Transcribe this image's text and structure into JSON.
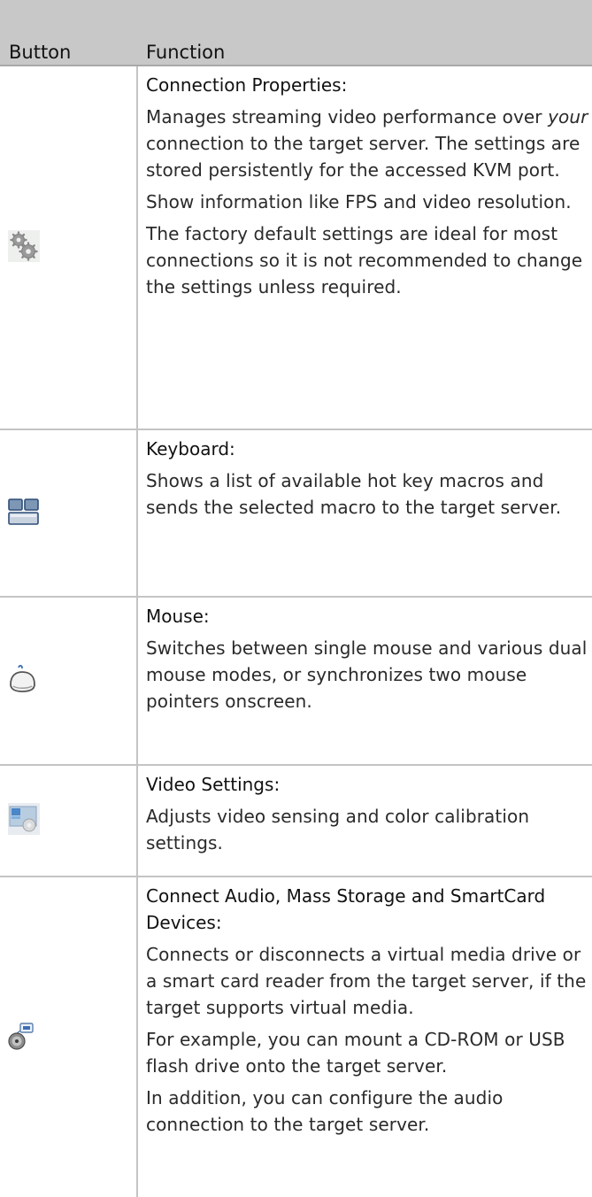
{
  "header": {
    "col_button": "Button",
    "col_function": "Function"
  },
  "rows": [
    {
      "icon": "gears-icon",
      "title": "Connection Properties",
      "title_suffix": ":",
      "p1_pre": "Manages streaming video performance over ",
      "p1_em": "your",
      "p1_post": " connection to the target server. The settings are stored persistently for the accessed KVM port.",
      "p2": "Show information like FPS and video resolution.",
      "p3": "The factory default settings are ideal for most connections so it is not recommended to change the settings unless required."
    },
    {
      "icon": "keyboard-icon",
      "title": "Keyboard",
      "title_suffix": ":",
      "p1": "Shows a list of available hot key macros and sends the selected macro to the target server."
    },
    {
      "icon": "mouse-icon",
      "title": "Mouse",
      "title_suffix": ":",
      "p1": "Switches between single mouse and various dual mouse modes, or synchronizes two mouse pointers onscreen."
    },
    {
      "icon": "video-settings-icon",
      "title": "Video Settings",
      "title_suffix": ":",
      "p1": "Adjusts video sensing and color calibration settings."
    },
    {
      "icon": "media-devices-icon",
      "title": "Connect Audio, Mass Storage and SmartCard Devices",
      "title_suffix": ":",
      "p1": "Connects or disconnects a virtual media drive or a smart card reader from the target server, if the target supports virtual media.",
      "p2": "For example, you can mount a CD-ROM or USB flash drive onto the target server.",
      "p3": "In addition, you can configure the audio connection to the target server."
    }
  ],
  "colors": {
    "header_bg": "#c8c8c8",
    "rule": "#c4c4c4",
    "text": "#2a2a2a"
  }
}
